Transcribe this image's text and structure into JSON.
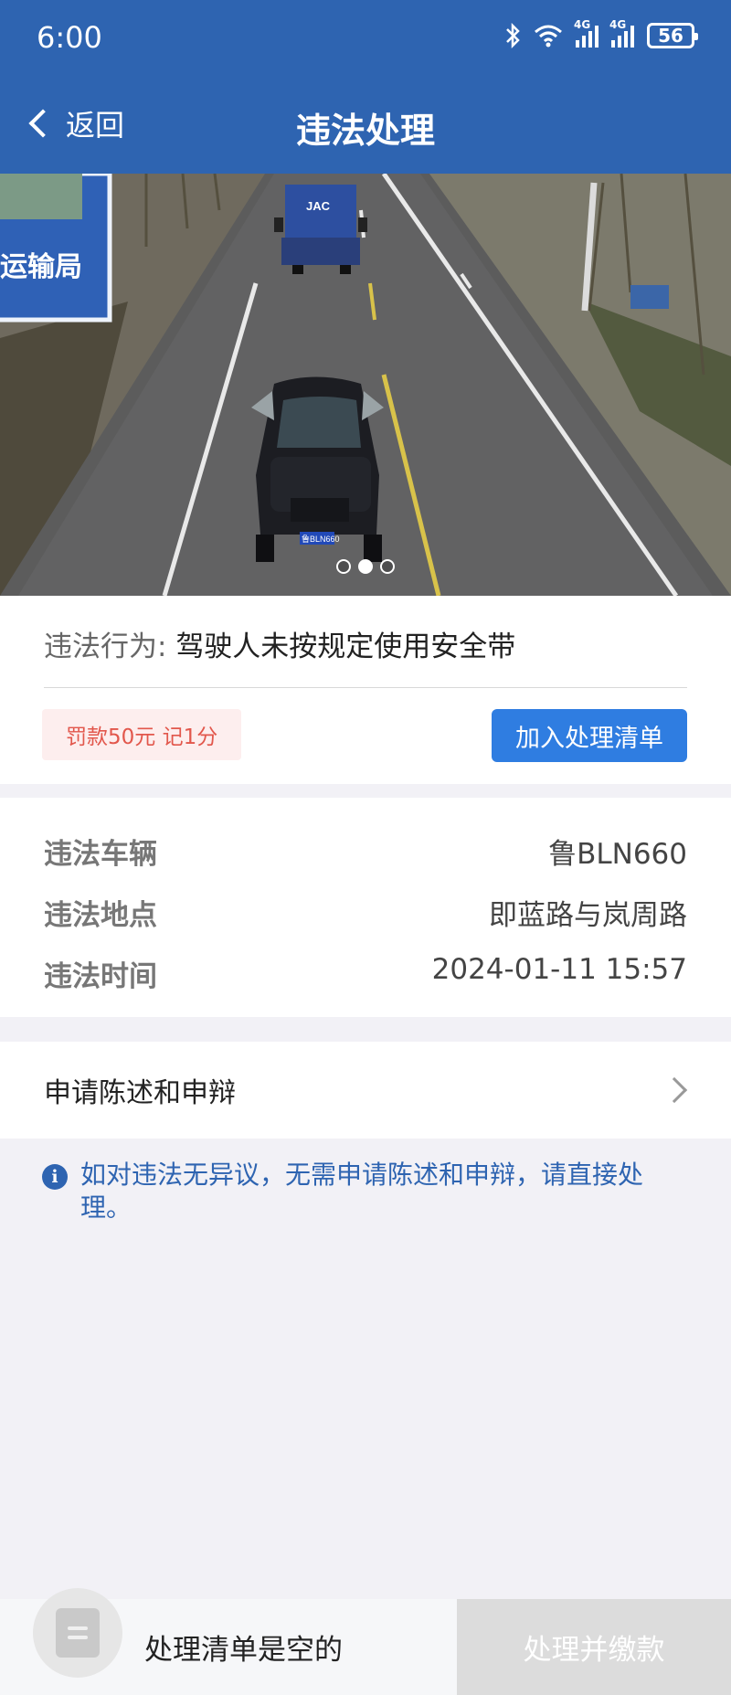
{
  "status_bar": {
    "time": "6:00",
    "network_1": "4G",
    "network_2": "4G",
    "battery": "56"
  },
  "nav": {
    "back_label": "返回",
    "title": "违法处理"
  },
  "photo": {
    "sign_text": "运输局",
    "truck_brand": "JAC",
    "plate_text": "鲁BLN660",
    "page_count": 3,
    "active_page": 2
  },
  "violation": {
    "behavior_key": "违法行为:",
    "behavior_value": "驾驶人未按规定使用安全带",
    "fine_badge": "罚款50元 记1分",
    "add_button": "加入处理清单"
  },
  "details": {
    "vehicle": {
      "label": "违法车辆",
      "value": "鲁BLN660"
    },
    "location": {
      "label": "违法地点",
      "value": "即蓝路与岚周路"
    },
    "time": {
      "label": "违法时间",
      "value": "2024-01-11 15:57"
    }
  },
  "appeal": {
    "label": "申请陈述和申辩"
  },
  "notice": {
    "icon": "i",
    "text": "如对违法无异议，无需申请陈述和申辩，请直接处理。"
  },
  "bottom": {
    "cart_text": "处理清单是空的",
    "pay_button": "处理并缴款"
  },
  "colors": {
    "brand_blue": "#2e64b1",
    "button_blue": "#2f7de1",
    "fine_red": "#e2574c"
  }
}
